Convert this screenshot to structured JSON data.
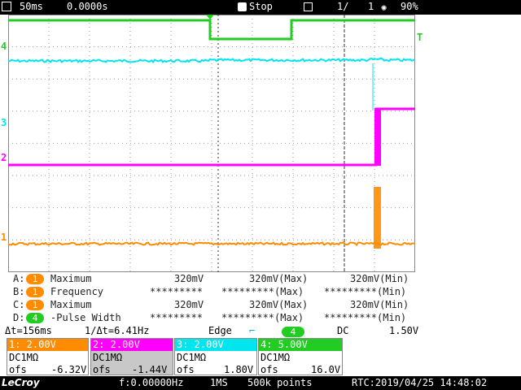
{
  "topbar": {
    "timebase": "50ms",
    "delay": "0.0000s",
    "run_state": "Stop",
    "sweeps_count": "1/",
    "sweeps_total": "1",
    "zoom_percent": "90%"
  },
  "markers": {
    "ch4": "4",
    "ch3": "3",
    "ch2": "2",
    "ch1": "1",
    "trigger": "T"
  },
  "measurements": [
    {
      "slot": "A:",
      "channel": "1",
      "name": "Maximum",
      "value": "320mV",
      "max": "320mV(Max)",
      "min": "320mV(Min)",
      "color": "#ff8c00"
    },
    {
      "slot": "B:",
      "channel": "1",
      "name": "Frequency",
      "value": "*********",
      "max": "*********(Max)",
      "min": "*********(Min)",
      "color": "#ff8c00"
    },
    {
      "slot": "C:",
      "channel": "1",
      "name": "Maximum",
      "value": "320mV",
      "max": "320mV(Max)",
      "min": "320mV(Min)",
      "color": "#ff8c00"
    },
    {
      "slot": "D:",
      "channel": "4",
      "name": "-Pulse Width",
      "value": "*********",
      "max": "*********(Max)",
      "min": "*********(Min)",
      "color": "#22cc22"
    }
  ],
  "trigger_info": {
    "delta_t": "Δt=156ms",
    "inv_delta_t": "1/Δt=6.41Hz",
    "mode": "Edge",
    "source": "4",
    "coupling": "DC",
    "level": "1.50V"
  },
  "channels": [
    {
      "header": "1: 2.00V",
      "coupling": "DC1MΩ",
      "ofs_label": "ofs",
      "ofs": "-6.32V",
      "color": "#ff8c00"
    },
    {
      "header": "2: 2.00V",
      "coupling": "DC1MΩ",
      "ofs_label": "ofs",
      "ofs": "-1.44V",
      "color": "#ff00ff"
    },
    {
      "header": "3: 2.00V",
      "coupling": "DC1MΩ",
      "ofs_label": "ofs",
      "ofs": "1.80V",
      "color": "#00e5ee"
    },
    {
      "header": "4: 5.00V",
      "coupling": "DC1MΩ",
      "ofs_label": "ofs",
      "ofs": "16.0V",
      "color": "#22cc22"
    }
  ],
  "bottombar": {
    "brand": "LeCroy",
    "freq": "f:0.00000Hz",
    "sample_rate": "1MS",
    "points": "500k points",
    "rtc": "RTC:2019/04/25 14:48:02"
  },
  "colors": {
    "ch1": "#ff8c00",
    "ch2": "#ff00ff",
    "ch3": "#00e5ee",
    "ch4": "#22cc22"
  }
}
